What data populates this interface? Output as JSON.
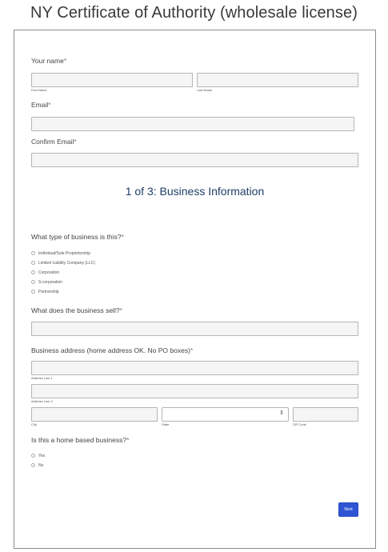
{
  "page": {
    "title": "NY Certificate of Authority (wholesale license)"
  },
  "form": {
    "name": {
      "label": "Your name",
      "required": "*",
      "first_label": "First Name",
      "last_label": "Last Name",
      "first_value": "",
      "last_value": ""
    },
    "email": {
      "label": "Email",
      "required": "*",
      "value": ""
    },
    "confirm_email": {
      "label": "Confirm Email",
      "required": "*",
      "value": ""
    },
    "section_heading": "1 of 3: Business Information",
    "business_type": {
      "label": "What type of business is this?",
      "required": "*",
      "options": [
        "Individual/Sole Proprietorship",
        "Limited Liability Company (LLC)",
        "Corporation",
        "S-corporation",
        "Partnership"
      ]
    },
    "sells": {
      "label": "What does the business sell?",
      "required": "*",
      "value": ""
    },
    "address": {
      "label": "Business address (home address OK. No PO boxes)",
      "required": "*",
      "line1_label": "Address Line 1",
      "line2_label": "Address Line 2",
      "city_label": "City",
      "state_label": "State",
      "zip_label": "ZIP Code",
      "state_value": ""
    },
    "home_based": {
      "label": "Is this a home based business?",
      "required": "*",
      "options": [
        "Yes",
        "No"
      ]
    },
    "next_label": "Next"
  }
}
